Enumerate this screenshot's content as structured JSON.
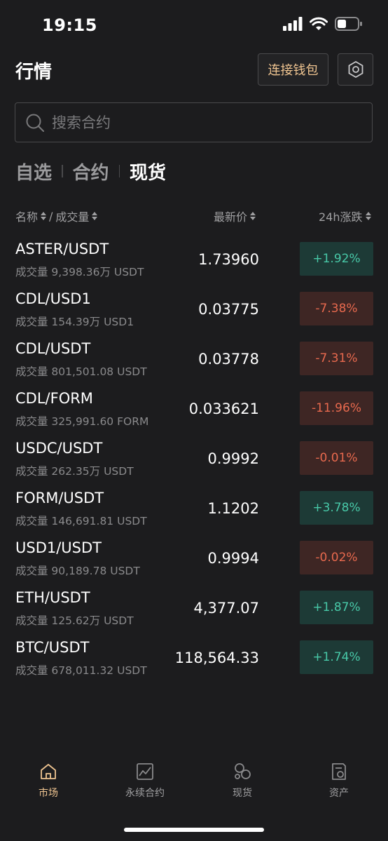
{
  "status_bar": {
    "time": "19:15"
  },
  "header": {
    "title": "行情",
    "wallet_button": "连接钱包"
  },
  "search": {
    "placeholder": "搜索合约"
  },
  "tabs": [
    {
      "label": "自选",
      "active": false
    },
    {
      "label": "合约",
      "active": false
    },
    {
      "label": "现货",
      "active": true
    }
  ],
  "columns": {
    "name": "名称",
    "sep": "/",
    "volume": "成交量",
    "price": "最新价",
    "change": "24h涨跌"
  },
  "colors": {
    "up": "#48c9a8",
    "down": "#e8694e",
    "accent": "#f0c591"
  },
  "markets": [
    {
      "pair": "ASTER/USDT",
      "volume": "成交量 9,398.36万 USDT",
      "price": "1.73960",
      "change": "+1.92%",
      "dir": "up"
    },
    {
      "pair": "CDL/USD1",
      "volume": "成交量 154.39万 USD1",
      "price": "0.03775",
      "change": "-7.38%",
      "dir": "down"
    },
    {
      "pair": "CDL/USDT",
      "volume": "成交量 801,501.08 USDT",
      "price": "0.03778",
      "change": "-7.31%",
      "dir": "down"
    },
    {
      "pair": "CDL/FORM",
      "volume": "成交量 325,991.60 FORM",
      "price": "0.033621",
      "change": "-11.96%",
      "dir": "down"
    },
    {
      "pair": "USDC/USDT",
      "volume": "成交量 262.35万 USDT",
      "price": "0.9992",
      "change": "-0.01%",
      "dir": "down"
    },
    {
      "pair": "FORM/USDT",
      "volume": "成交量 146,691.81 USDT",
      "price": "1.1202",
      "change": "+3.78%",
      "dir": "up"
    },
    {
      "pair": "USD1/USDT",
      "volume": "成交量 90,189.78 USDT",
      "price": "0.9994",
      "change": "-0.02%",
      "dir": "down"
    },
    {
      "pair": "ETH/USDT",
      "volume": "成交量 125.62万 USDT",
      "price": "4,377.07",
      "change": "+1.87%",
      "dir": "up"
    },
    {
      "pair": "BTC/USDT",
      "volume": "成交量 678,011.32 USDT",
      "price": "118,564.33",
      "change": "+1.74%",
      "dir": "up"
    }
  ],
  "bottom_nav": [
    {
      "label": "市场",
      "icon": "home-icon",
      "active": true
    },
    {
      "label": "永续合约",
      "icon": "chart-icon",
      "active": false
    },
    {
      "label": "现货",
      "icon": "coins-icon",
      "active": false
    },
    {
      "label": "资产",
      "icon": "document-icon",
      "active": false
    }
  ]
}
